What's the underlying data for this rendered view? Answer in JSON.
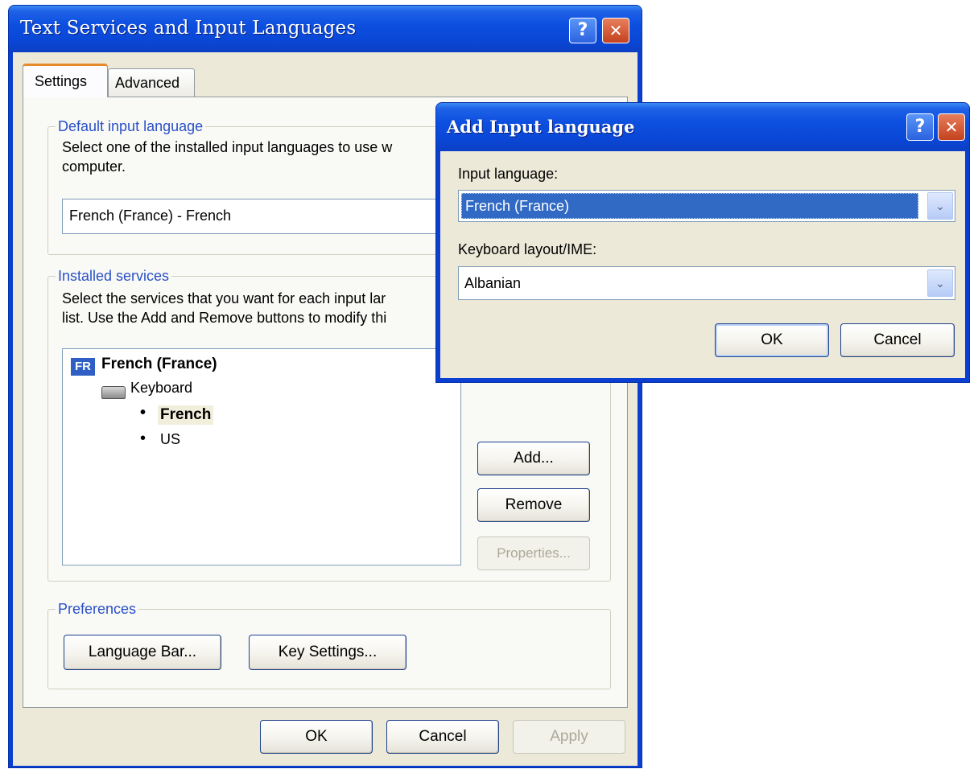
{
  "main_dialog": {
    "title": "Text Services and Input Languages",
    "tabs": [
      {
        "label": "Settings",
        "active": true
      },
      {
        "label": "Advanced",
        "active": false
      }
    ],
    "default_language": {
      "group_label": "Default input language",
      "description_line1": "Select one of the installed input languages to use w",
      "description_line2": "computer.",
      "selected_value": "French (France) - French"
    },
    "installed_services": {
      "group_label": "Installed services",
      "description_line1": "Select the services that you want for each input lar",
      "description_line2": "list. Use the Add and Remove buttons to modify thi",
      "tree": {
        "language_badge": "FR",
        "language": "French (France)",
        "category": "Keyboard",
        "layouts": [
          "French",
          "US"
        ]
      },
      "add_label": "Add...",
      "remove_label": "Remove",
      "properties_label": "Properties..."
    },
    "preferences": {
      "group_label": "Preferences",
      "language_bar_label": "Language Bar...",
      "key_settings_label": "Key Settings..."
    },
    "ok_label": "OK",
    "cancel_label": "Cancel",
    "apply_label": "Apply"
  },
  "add_dialog": {
    "title": "Add Input language",
    "input_language_label": "Input language:",
    "input_language_value": "French (France)",
    "keyboard_label": "Keyboard layout/IME:",
    "keyboard_value": "Albanian",
    "ok_label": "OK",
    "cancel_label": "Cancel"
  },
  "titlebar_buttons": {
    "help": "?",
    "close": "✕"
  },
  "colors": {
    "titlebar": "#0a47d6",
    "client": "#ece9d8",
    "group_label": "#2a51c7",
    "selection": "#316ac5"
  },
  "icons": {
    "help": "help-icon",
    "close": "close-icon",
    "combo": "chevron-down-icon",
    "keyboard": "keyboard-icon",
    "language_badge": "language-badge-icon"
  }
}
